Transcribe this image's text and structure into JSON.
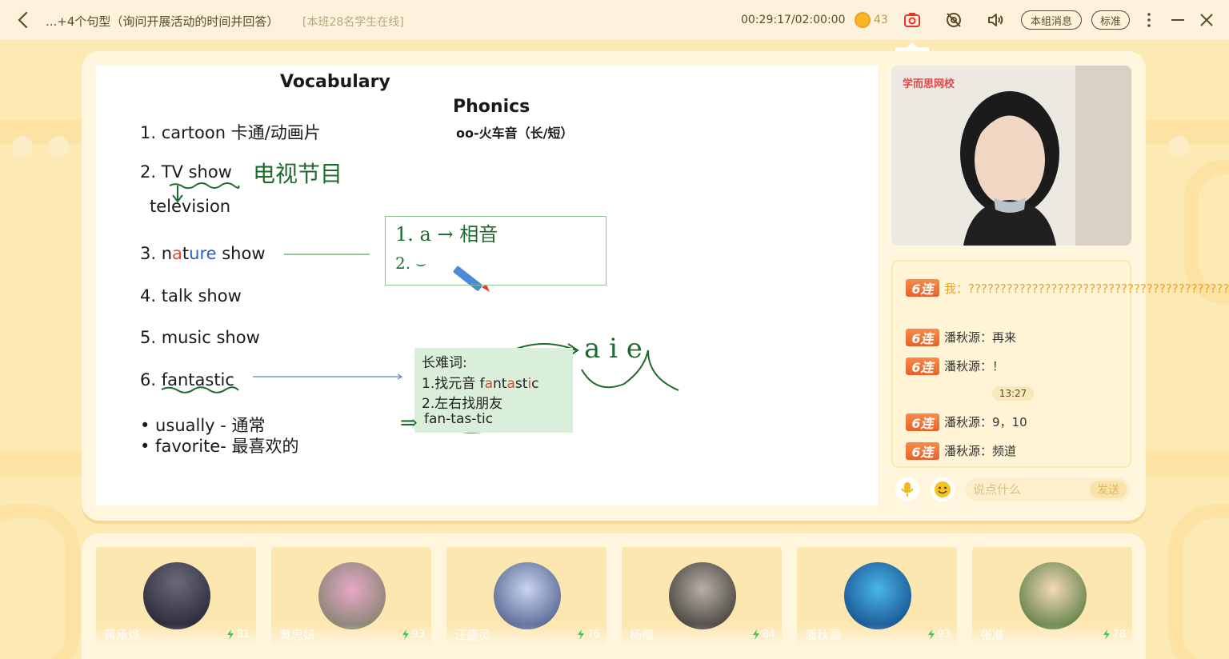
{
  "topbar": {
    "title": "...+4个句型（询问开展活动的时间并回答）",
    "online": "[本班28名学生在线]",
    "timer": "00:29:17/02:00:00",
    "coins": "43",
    "group_msg_label": "本组消息",
    "quality_label": "标准",
    "screenshot_tooltip": "截屏"
  },
  "whiteboard": {
    "vocab_title": "Vocabulary",
    "phonics_title": "Phonics",
    "phonics_sub": "oo-火车音（长/短）",
    "items": {
      "i1": "1.  cartoon 卡通/动画片",
      "i2": "2.  TV show",
      "i2b": "television",
      "i3_pre": "3. n",
      "i3_a": "a",
      "i3_mid": "t",
      "i3_u": "ure",
      "i3_post": " show",
      "i4": "4. talk show",
      "i5": "5. music show",
      "i6": "6. fantastic",
      "b1": "•   usually - 通常",
      "b2": "•   favorite- 最喜欢的"
    },
    "hand_tv": "电视节目",
    "hand_note1": "1. a → 相音",
    "hand_note2": "2. ⌣",
    "hand_vowels": "a i e",
    "green_box": {
      "title": "长难词:",
      "line1_pre": "1.找元音 f",
      "line1_a": "a",
      "line1_n": "nt",
      "line1_a2": "a",
      "line1_st": "st",
      "line1_i": "i",
      "line1_c": "c",
      "line2": "2.左右找朋友",
      "line3": "fan-tas-tic",
      "arrow": "⇒"
    }
  },
  "video": {
    "logo": "学而思网校"
  },
  "chat": {
    "badge": "6连",
    "messages": [
      {
        "sender": "我",
        "text": "我：?????????????????????????????????????????"
      },
      {
        "sender": "潘秋源",
        "text": "潘秋源：再来"
      },
      {
        "sender": "潘秋源",
        "text": "潘秋源：！"
      },
      {
        "sender": "潘秋源",
        "text": "潘秋源：9，10"
      },
      {
        "sender": "潘秋源",
        "text": "潘秋源：频道"
      }
    ],
    "time_chip": "13:27",
    "input_placeholder": "说点什么",
    "send_label": "发送"
  },
  "students": [
    {
      "name": "蒋承烨",
      "score": "81"
    },
    {
      "name": "黄思妍",
      "score": "93"
    },
    {
      "name": "汪盛灵",
      "score": "76"
    },
    {
      "name": "杨樱",
      "score": "84"
    },
    {
      "name": "潘秋源",
      "score": "93"
    },
    {
      "name": "张准",
      "score": "78"
    }
  ],
  "colors": {
    "accent": "#e8622a",
    "background": "#fde9b4",
    "panel": "#fff6dd",
    "hand_ink": "#1f6b2e"
  }
}
